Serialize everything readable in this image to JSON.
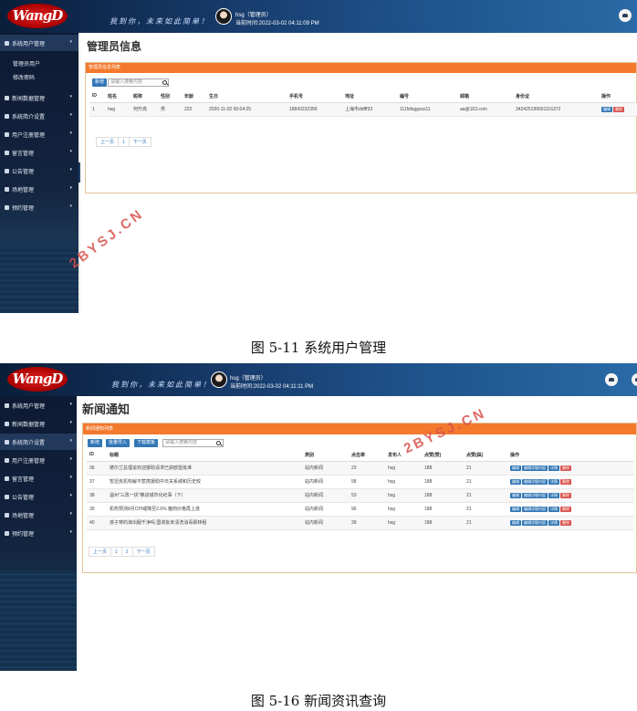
{
  "shot1": {
    "logo": "WangD",
    "slogan": "我到你，未来如此简单！",
    "user": {
      "name": "hsg（管理员）",
      "login_time": "当前时间:2022-03-02 04:11:09 PM"
    },
    "menu": [
      "系统用户管理",
      "新闻数据管理",
      "系统简介设置",
      "用户注册管理",
      "留言管理",
      "公告管理",
      "场地管理",
      "预约管理"
    ],
    "submenu": [
      "管理员用户",
      "修改密码"
    ],
    "page_title": "管理员信息",
    "panel_title": "管理员信息列表",
    "buttons": {
      "add": "新增"
    },
    "search_placeholder": "请输入搜索内容",
    "columns": [
      "ID",
      "姓名",
      "昵称",
      "性别",
      "年龄",
      "生日",
      "手机号",
      "地址",
      "编号",
      "邮箱",
      "身份证",
      "操作"
    ],
    "rows": [
      [
        "1",
        "hsg",
        "何升高",
        "男",
        "222",
        "2020-11-02 00:04:25",
        "18843232356",
        "上海市ddfff33",
        "111fsfsggsss11",
        "aa@163.com",
        "342425199001116372"
      ]
    ],
    "row_actions": [
      "编辑",
      "删除"
    ],
    "pager": [
      "上一页",
      "1",
      "下一页"
    ],
    "watermark": "2BYSJ.CN"
  },
  "caption1": "图 5-11 系统用户管理",
  "shot2": {
    "logo": "WangD",
    "slogan": "我到你，未来如此简单！",
    "user": {
      "name": "hsg（管理员）",
      "login_time": "当前时间:2022-03-02 04:11:11 PM"
    },
    "menu": [
      "系统用户管理",
      "新闻数据管理",
      "系统简介设置",
      "用户注册管理",
      "留言管理",
      "公告管理",
      "场地管理",
      "预约管理"
    ],
    "page_title": "新闻通知",
    "panel_title": "新闻通知列表",
    "buttons": {
      "add": "新增",
      "import": "批量导入",
      "template": "下载模板"
    },
    "search_placeholder": "请输入搜索内容",
    "columns": [
      "ID",
      "标题",
      "类别",
      "点击率",
      "发布人",
      "点赞(赞)",
      "点赞(踩)",
      "操作"
    ],
    "rows": [
      [
        "36",
        "德尔兰总理说欢迎援助请求已获欧盟批准",
        "站内新闻",
        "23",
        "hsg",
        "188",
        "21"
      ],
      [
        "37",
        "暂坦克机构解不惹携援助中日关系城和历史较",
        "站内新闻",
        "58",
        "hsg",
        "188",
        "21"
      ],
      [
        "38",
        "温州\"三改一拆\"推进城市化纪事（下）",
        "站内新闻",
        "53",
        "hsg",
        "188",
        "21"
      ],
      [
        "39",
        "机构预测8月CPI或降至2.6% 猪肉价格再上涨",
        "站内新闻",
        "96",
        "hsg",
        "188",
        "21"
      ],
      [
        "40",
        "孩子穿的演出服千净吗 国收批未清洗消毒即转租",
        "站内新闻",
        "39",
        "hsg",
        "188",
        "21"
      ]
    ],
    "row_actions": [
      "编辑",
      "编辑详细内容",
      "详情",
      "删除"
    ],
    "pager": [
      "上一页",
      "1",
      "2",
      "下一页"
    ],
    "watermark": "2BYSJ.CN"
  },
  "caption2": "图 5-16 新闻资讯查询"
}
